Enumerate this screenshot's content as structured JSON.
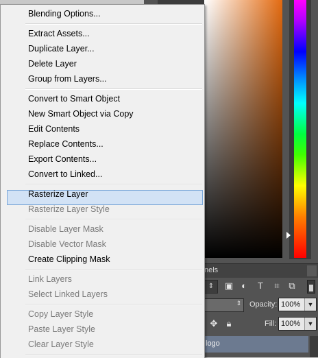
{
  "context_menu": {
    "groups": [
      [
        {
          "label": "Blending Options...",
          "enabled": true
        }
      ],
      [
        {
          "label": "Extract Assets...",
          "enabled": true
        },
        {
          "label": "Duplicate Layer...",
          "enabled": true
        },
        {
          "label": "Delete Layer",
          "enabled": true
        },
        {
          "label": "Group from Layers...",
          "enabled": true
        }
      ],
      [
        {
          "label": "Convert to Smart Object",
          "enabled": true
        },
        {
          "label": "New Smart Object via Copy",
          "enabled": true
        },
        {
          "label": "Edit Contents",
          "enabled": true
        },
        {
          "label": "Replace Contents...",
          "enabled": true
        },
        {
          "label": "Export Contents...",
          "enabled": true
        },
        {
          "label": "Convert to Linked...",
          "enabled": true
        }
      ],
      [
        {
          "label": "Rasterize Layer",
          "enabled": true,
          "highlighted": true
        },
        {
          "label": "Rasterize Layer Style",
          "enabled": false
        }
      ],
      [
        {
          "label": "Disable Layer Mask",
          "enabled": false
        },
        {
          "label": "Disable Vector Mask",
          "enabled": false
        },
        {
          "label": "Create Clipping Mask",
          "enabled": true
        }
      ],
      [
        {
          "label": "Link Layers",
          "enabled": false
        },
        {
          "label": "Select Linked Layers",
          "enabled": false
        }
      ],
      [
        {
          "label": "Copy Layer Style",
          "enabled": false
        },
        {
          "label": "Paste Layer Style",
          "enabled": false
        },
        {
          "label": "Clear Layer Style",
          "enabled": false
        }
      ]
    ]
  },
  "layers_panel": {
    "tab_label": "nels",
    "opacity_label": "Opacity:",
    "opacity_value": "100%",
    "fill_label": "Fill:",
    "fill_value": "100%",
    "layer_name": "logo"
  },
  "color_picker": {
    "base_color": "#e36a10"
  },
  "colors": {
    "highlight": "#d2e2f5",
    "highlight_border": "#7ba7d8",
    "selected_layer": "#6c7a90"
  }
}
